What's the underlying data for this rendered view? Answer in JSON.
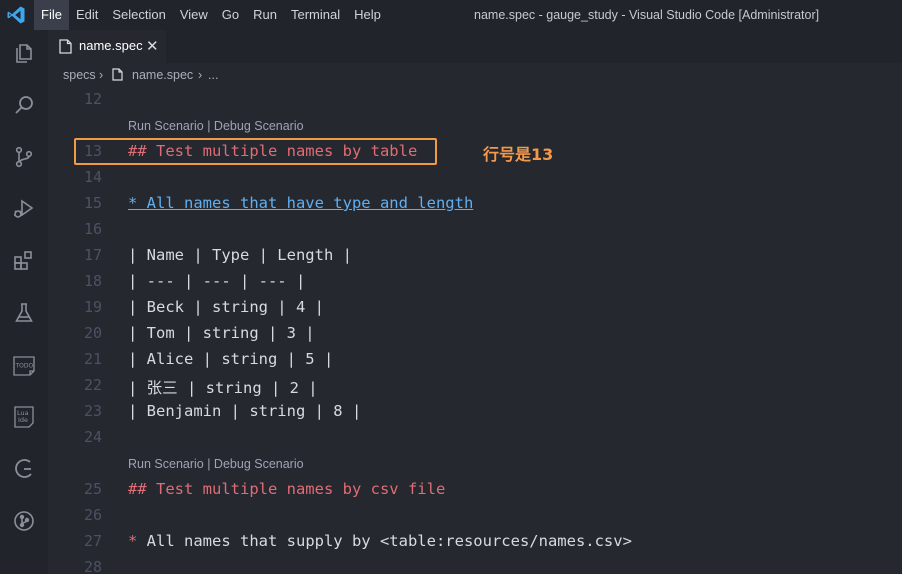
{
  "window_title": "name.spec - gauge_study - Visual Studio Code [Administrator]",
  "menu": [
    "File",
    "Edit",
    "Selection",
    "View",
    "Go",
    "Run",
    "Terminal",
    "Help"
  ],
  "activity_icons": [
    "explorer-icon",
    "search-icon",
    "source-control-icon",
    "run-debug-icon",
    "extensions-icon",
    "testing-flask-icon",
    "todo-icon",
    "lua-ide-icon",
    "gauge-icon",
    "git-graph-icon"
  ],
  "activity_labels": {
    "todo": "TODO",
    "lua_top": "Lua",
    "lua_bottom": "Ide"
  },
  "tab": {
    "label": "name.spec",
    "close": "✕"
  },
  "breadcrumb": {
    "folder": "specs",
    "sep": "›",
    "file": "name.spec",
    "more": "..."
  },
  "codelens": {
    "text": "Run Scenario | Debug Scenario"
  },
  "annotation": "行号是13",
  "lines": [
    {
      "num": "12",
      "text": ""
    },
    {
      "num": "13",
      "text": "## Test multiple names by table"
    },
    {
      "num": "14",
      "text": ""
    },
    {
      "num": "15",
      "text": "* All names that have type and length"
    },
    {
      "num": "16",
      "text": ""
    },
    {
      "num": "17",
      "text": "| Name | Type | Length |"
    },
    {
      "num": "18",
      "text": "| --- | --- | --- |"
    },
    {
      "num": "19",
      "text": "| Beck | string | 4 |"
    },
    {
      "num": "20",
      "text": "| Tom | string | 3 |"
    },
    {
      "num": "21",
      "text": "| Alice | string | 5 |"
    },
    {
      "num": "22",
      "text": "| 张三 | string | 2 |"
    },
    {
      "num": "23",
      "text": "| Benjamin | string | 8 |"
    },
    {
      "num": "24",
      "text": ""
    },
    {
      "num": "25",
      "text": "## Test multiple names by csv file"
    },
    {
      "num": "26",
      "text": ""
    },
    {
      "num": "27",
      "bullet": "*",
      "text": " All names that supply by <table:resources/names.csv>"
    },
    {
      "num": "28",
      "text": ""
    }
  ],
  "colors": {
    "accent": "#f2994a",
    "heading": "#e06c75",
    "link": "#61afef",
    "background": "#25282f"
  }
}
